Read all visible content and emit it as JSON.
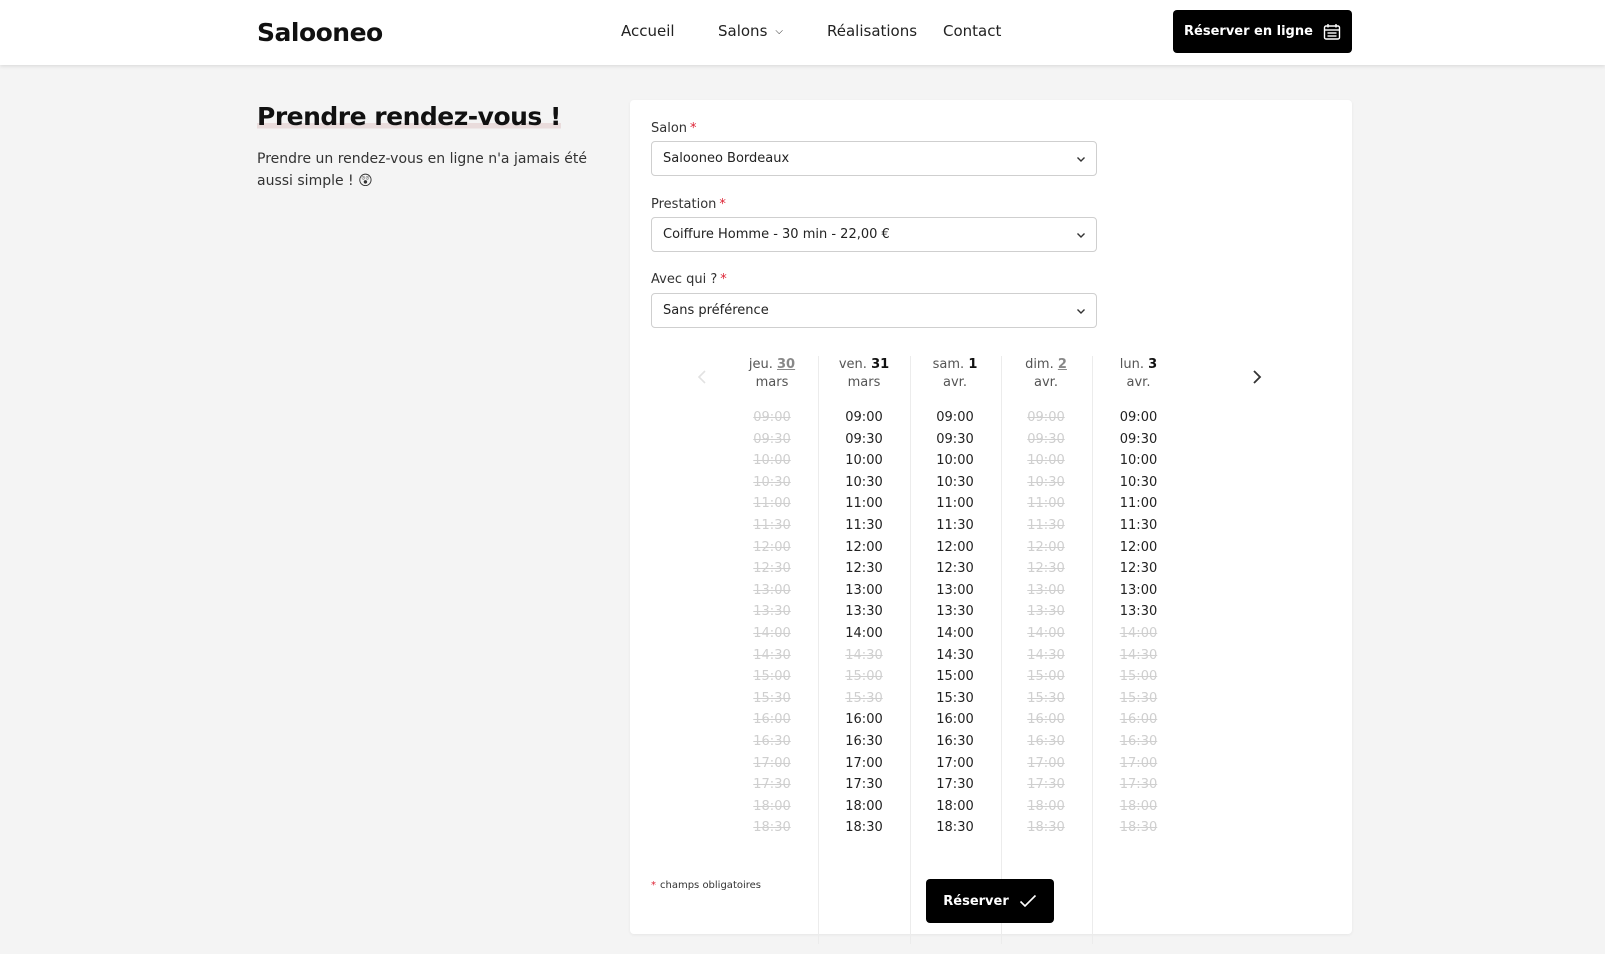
{
  "header": {
    "logo": "Salooneo",
    "nav": {
      "accueil": "Accueil",
      "salons": "Salons",
      "realisations": "Réalisations",
      "contact": "Contact"
    },
    "cta_label": "Réserver en ligne"
  },
  "intro": {
    "title": "Prendre rendez-vous !",
    "text": "Prendre un rendez-vous en ligne n'a jamais été aussi simple ! 😲"
  },
  "form": {
    "salon": {
      "label": "Salon",
      "value": "Salooneo Bordeaux"
    },
    "prestation": {
      "label": "Prestation",
      "value": "Coiffure Homme - 30 min - 22,00 €"
    },
    "avec_qui": {
      "label": "Avec qui ?",
      "value": "Sans préférence"
    },
    "required_marker": "*",
    "footnote": "champs obligatoires",
    "submit_label": "Réserver"
  },
  "calendar": {
    "times": [
      "09:00",
      "09:30",
      "10:00",
      "10:30",
      "11:00",
      "11:30",
      "12:00",
      "12:30",
      "13:00",
      "13:30",
      "14:00",
      "14:30",
      "15:00",
      "15:30",
      "16:00",
      "16:30",
      "17:00",
      "17:30",
      "18:00",
      "18:30"
    ],
    "days": [
      {
        "weekday": "jeu.",
        "day": "30",
        "month": "mars",
        "available": [
          false,
          false,
          false,
          false,
          false,
          false,
          false,
          false,
          false,
          false,
          false,
          false,
          false,
          false,
          false,
          false,
          false,
          false,
          false,
          false
        ]
      },
      {
        "weekday": "ven.",
        "day": "31",
        "month": "mars",
        "available": [
          true,
          true,
          true,
          true,
          true,
          true,
          true,
          true,
          true,
          true,
          true,
          false,
          false,
          false,
          true,
          true,
          true,
          true,
          true,
          true
        ]
      },
      {
        "weekday": "sam.",
        "day": "1",
        "month": "avr.",
        "available": [
          true,
          true,
          true,
          true,
          true,
          true,
          true,
          true,
          true,
          true,
          true,
          true,
          true,
          true,
          true,
          true,
          true,
          true,
          true,
          true
        ]
      },
      {
        "weekday": "dim.",
        "day": "2",
        "month": "avr.",
        "available": [
          false,
          false,
          false,
          false,
          false,
          false,
          false,
          false,
          false,
          false,
          false,
          false,
          false,
          false,
          false,
          false,
          false,
          false,
          false,
          false
        ]
      },
      {
        "weekday": "lun.",
        "day": "3",
        "month": "avr.",
        "available": [
          true,
          true,
          true,
          true,
          true,
          true,
          true,
          true,
          true,
          true,
          false,
          false,
          false,
          false,
          false,
          false,
          false,
          false,
          false,
          false
        ]
      }
    ]
  }
}
